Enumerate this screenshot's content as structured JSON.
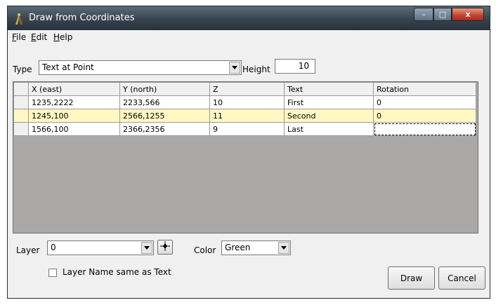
{
  "window": {
    "title": "Draw from Coordinates",
    "title_buttons": {
      "minimize": "–",
      "maximize": "□",
      "close": "x"
    }
  },
  "menu": {
    "items": [
      {
        "label_underlined": "F",
        "label_rest": "ile"
      },
      {
        "label_underlined": "E",
        "label_rest": "dit"
      },
      {
        "label_underlined": "H",
        "label_rest": "elp"
      }
    ]
  },
  "type_field": {
    "label": "Type",
    "value": "Text at Point"
  },
  "height_field": {
    "label": "Height",
    "value": "10"
  },
  "grid": {
    "columns": [
      "X (east)",
      "Y (north)",
      "Z",
      "Text",
      "Rotation"
    ],
    "rows": [
      {
        "x": "1235,2222",
        "y": "2233,566",
        "z": "10",
        "text": "First",
        "rotation": "0"
      },
      {
        "x": "1245,100",
        "y": "2566,1255",
        "z": "11",
        "text": "Second",
        "rotation": "0"
      },
      {
        "x": "1566,100",
        "y": "2366,2356",
        "z": "9",
        "text": "Last",
        "rotation": ""
      }
    ]
  },
  "layer_field": {
    "label": "Layer",
    "value": "0"
  },
  "color_field": {
    "label": "Color",
    "value": "Green"
  },
  "layer_name_checkbox": {
    "label": "Layer Name same as Text",
    "checked": false
  },
  "buttons": {
    "draw": "Draw",
    "cancel": "Cancel"
  },
  "icons": {
    "app": "compass-icon",
    "pick": "crosshair-icon"
  }
}
